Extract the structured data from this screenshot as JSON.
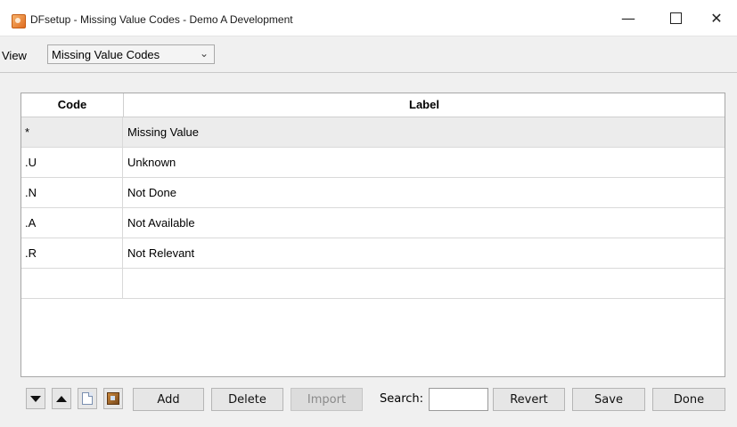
{
  "window": {
    "title": "DFsetup - Missing Value Codes - Demo A Development",
    "minimize_glyph": "—",
    "close_glyph": "✕"
  },
  "view": {
    "label": "View",
    "selected": "Missing Value Codes"
  },
  "table": {
    "columns": [
      "Code",
      "Label"
    ],
    "rows": [
      {
        "code": "*",
        "label": "Missing Value"
      },
      {
        "code": ".U",
        "label": "Unknown"
      },
      {
        "code": ".N",
        "label": "Not Done"
      },
      {
        "code": ".A",
        "label": "Not Available"
      },
      {
        "code": ".R",
        "label": "Not Relevant"
      },
      {
        "code": "",
        "label": ""
      }
    ]
  },
  "toolbar": {
    "add": "Add",
    "delete": "Delete",
    "import": "Import",
    "search_label": "Search:",
    "search_value": "",
    "revert": "Revert",
    "save": "Save",
    "done": "Done"
  },
  "icons": [
    "move-down-icon",
    "move-up-icon",
    "new-document-icon",
    "import-file-icon"
  ],
  "colors": {
    "selected_row": "#ececec",
    "app_icon": "#e06c1f"
  }
}
